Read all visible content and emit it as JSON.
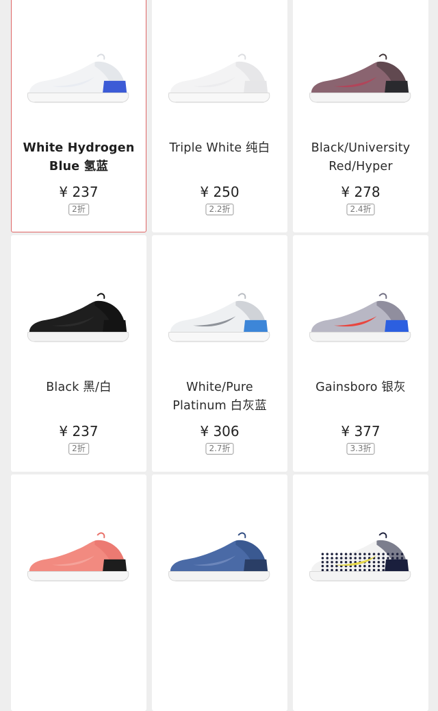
{
  "products": [
    {
      "name_l1": "White Hydrogen",
      "name_l2": "Blue 氢蓝",
      "price": "¥ 237",
      "discount": "2折",
      "selected": true,
      "colors": {
        "upper": "#f2f3f5",
        "upper_dark": "#d9dce1",
        "sole": "#f7f7f7",
        "heel": "#3c5bd6",
        "accent": "#e9ecf2"
      }
    },
    {
      "name_l1": "Triple White 纯白",
      "name_l2": "",
      "price": "¥ 250",
      "discount": "2.2折",
      "selected": false,
      "colors": {
        "upper": "#f3f3f4",
        "upper_dark": "#dcdde0",
        "sole": "#f8f8f8",
        "heel": "#e6e6e8",
        "accent": "#ececee"
      }
    },
    {
      "name_l1": "Black/University",
      "name_l2": "Red/Hyper",
      "price": "¥ 278",
      "discount": "2.4折",
      "selected": false,
      "colors": {
        "upper": "#8a6470",
        "upper_dark": "#3f3336",
        "sole": "#f4f4f4",
        "heel": "#2a2a2e",
        "accent": "#b1455a"
      }
    },
    {
      "name_l1": "Black 黑/白",
      "name_l2": "",
      "price": "¥ 237",
      "discount": "2折",
      "selected": false,
      "colors": {
        "upper": "#1e1e1e",
        "upper_dark": "#0d0d0d",
        "sole": "#f4f4f4",
        "heel": "#141414",
        "accent": "#2b2b2b"
      }
    },
    {
      "name_l1": "White/Pure",
      "name_l2": "Platinum 白灰蓝",
      "price": "¥ 306",
      "discount": "2.7折",
      "selected": false,
      "colors": {
        "upper": "#eef0f2",
        "upper_dark": "#b8bcc2",
        "sole": "#f8f8f8",
        "heel": "#3d86d8",
        "accent": "#8f939a"
      }
    },
    {
      "name_l1": "Gainsboro 银灰",
      "name_l2": "",
      "price": "¥ 377",
      "discount": "3.3折",
      "selected": false,
      "colors": {
        "upper": "#b8b7c4",
        "upper_dark": "#6f6d80",
        "sole": "#f4f4f4",
        "heel": "#2c5fe0",
        "accent": "#e8463f"
      }
    },
    {
      "name_l1": "",
      "name_l2": "",
      "price": "",
      "discount": "",
      "selected": false,
      "colors": {
        "upper": "#f28a80",
        "upper_dark": "#e86e66",
        "sole": "#f6f6f6",
        "heel": "#1d1d1d",
        "accent": "#f5a39a"
      }
    },
    {
      "name_l1": "",
      "name_l2": "",
      "price": "",
      "discount": "",
      "selected": false,
      "colors": {
        "upper": "#4a6aa6",
        "upper_dark": "#2e4a80",
        "sole": "#f4f4f4",
        "heel": "#2a3e66",
        "accent": "#6c86bb"
      }
    },
    {
      "name_l1": "",
      "name_l2": "",
      "price": "",
      "discount": "",
      "selected": false,
      "colors": {
        "upper": "#f2f2f2",
        "upper_dark": "#1b1f3a",
        "sole": "#f4f4f4",
        "heel": "#1a1f3d",
        "accent": "#e6d84a"
      }
    }
  ]
}
